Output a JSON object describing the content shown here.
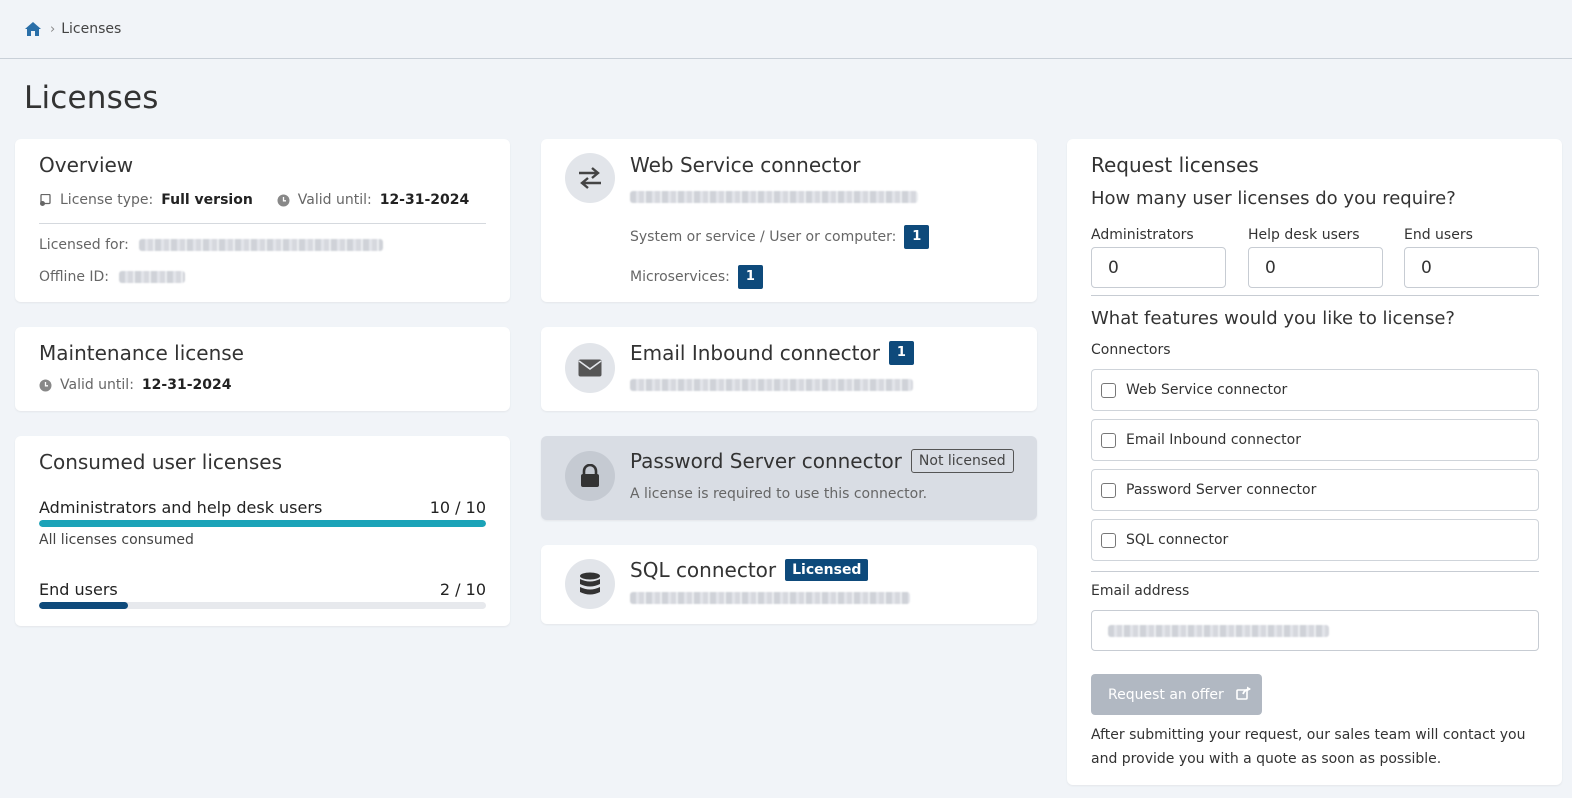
{
  "breadcrumb": {
    "current": "Licenses"
  },
  "page_title": "Licenses",
  "overview": {
    "title": "Overview",
    "license_type_label": "License type:",
    "license_type_value": "Full version",
    "valid_until_label": "Valid until:",
    "valid_until_value": "12-31-2024",
    "licensed_for_label": "Licensed for:",
    "offline_id_label": "Offline ID:"
  },
  "maintenance": {
    "title": "Maintenance license",
    "valid_until_label": "Valid until:",
    "valid_until_value": "12-31-2024"
  },
  "consumed": {
    "title": "Consumed user licenses",
    "admins_label": "Administrators and help desk users",
    "admins_count": "10 / 10",
    "admins_fraction": 1.0,
    "admins_note": "All licenses consumed",
    "end_users_label": "End users",
    "end_users_count": "2 / 10",
    "end_users_fraction": 0.2
  },
  "connectors": {
    "web_service": {
      "title": "Web Service connector",
      "system_label": "System or service / User or computer:",
      "system_count": "1",
      "micro_label": "Microservices:",
      "micro_count": "1"
    },
    "email_inbound": {
      "title": "Email Inbound connector",
      "count": "1"
    },
    "password_server": {
      "title": "Password Server connector",
      "badge": "Not licensed",
      "note": "A license is required to use this connector."
    },
    "sql": {
      "title": "SQL connector",
      "badge": "Licensed"
    }
  },
  "request": {
    "title": "Request licenses",
    "question_users": "How many user licenses do you require?",
    "admins_label": "Administrators",
    "admins_value": "0",
    "helpdesk_label": "Help desk users",
    "helpdesk_value": "0",
    "endusers_label": "End users",
    "endusers_value": "0",
    "question_features": "What features would you like to license?",
    "connectors_label": "Connectors",
    "options": [
      "Web Service connector",
      "Email Inbound connector",
      "Password Server connector",
      "SQL connector"
    ],
    "email_label": "Email address",
    "button_label": "Request an offer",
    "footer_note": "After submitting your request, our sales team will contact you and provide you with a quote as soon as possible."
  },
  "colors": {
    "accent_dark": "#0e4a7b",
    "progress_teal": "#1ba3b8",
    "progress_navy": "#0e4a7b",
    "disabled_button": "#b1b8c2"
  }
}
